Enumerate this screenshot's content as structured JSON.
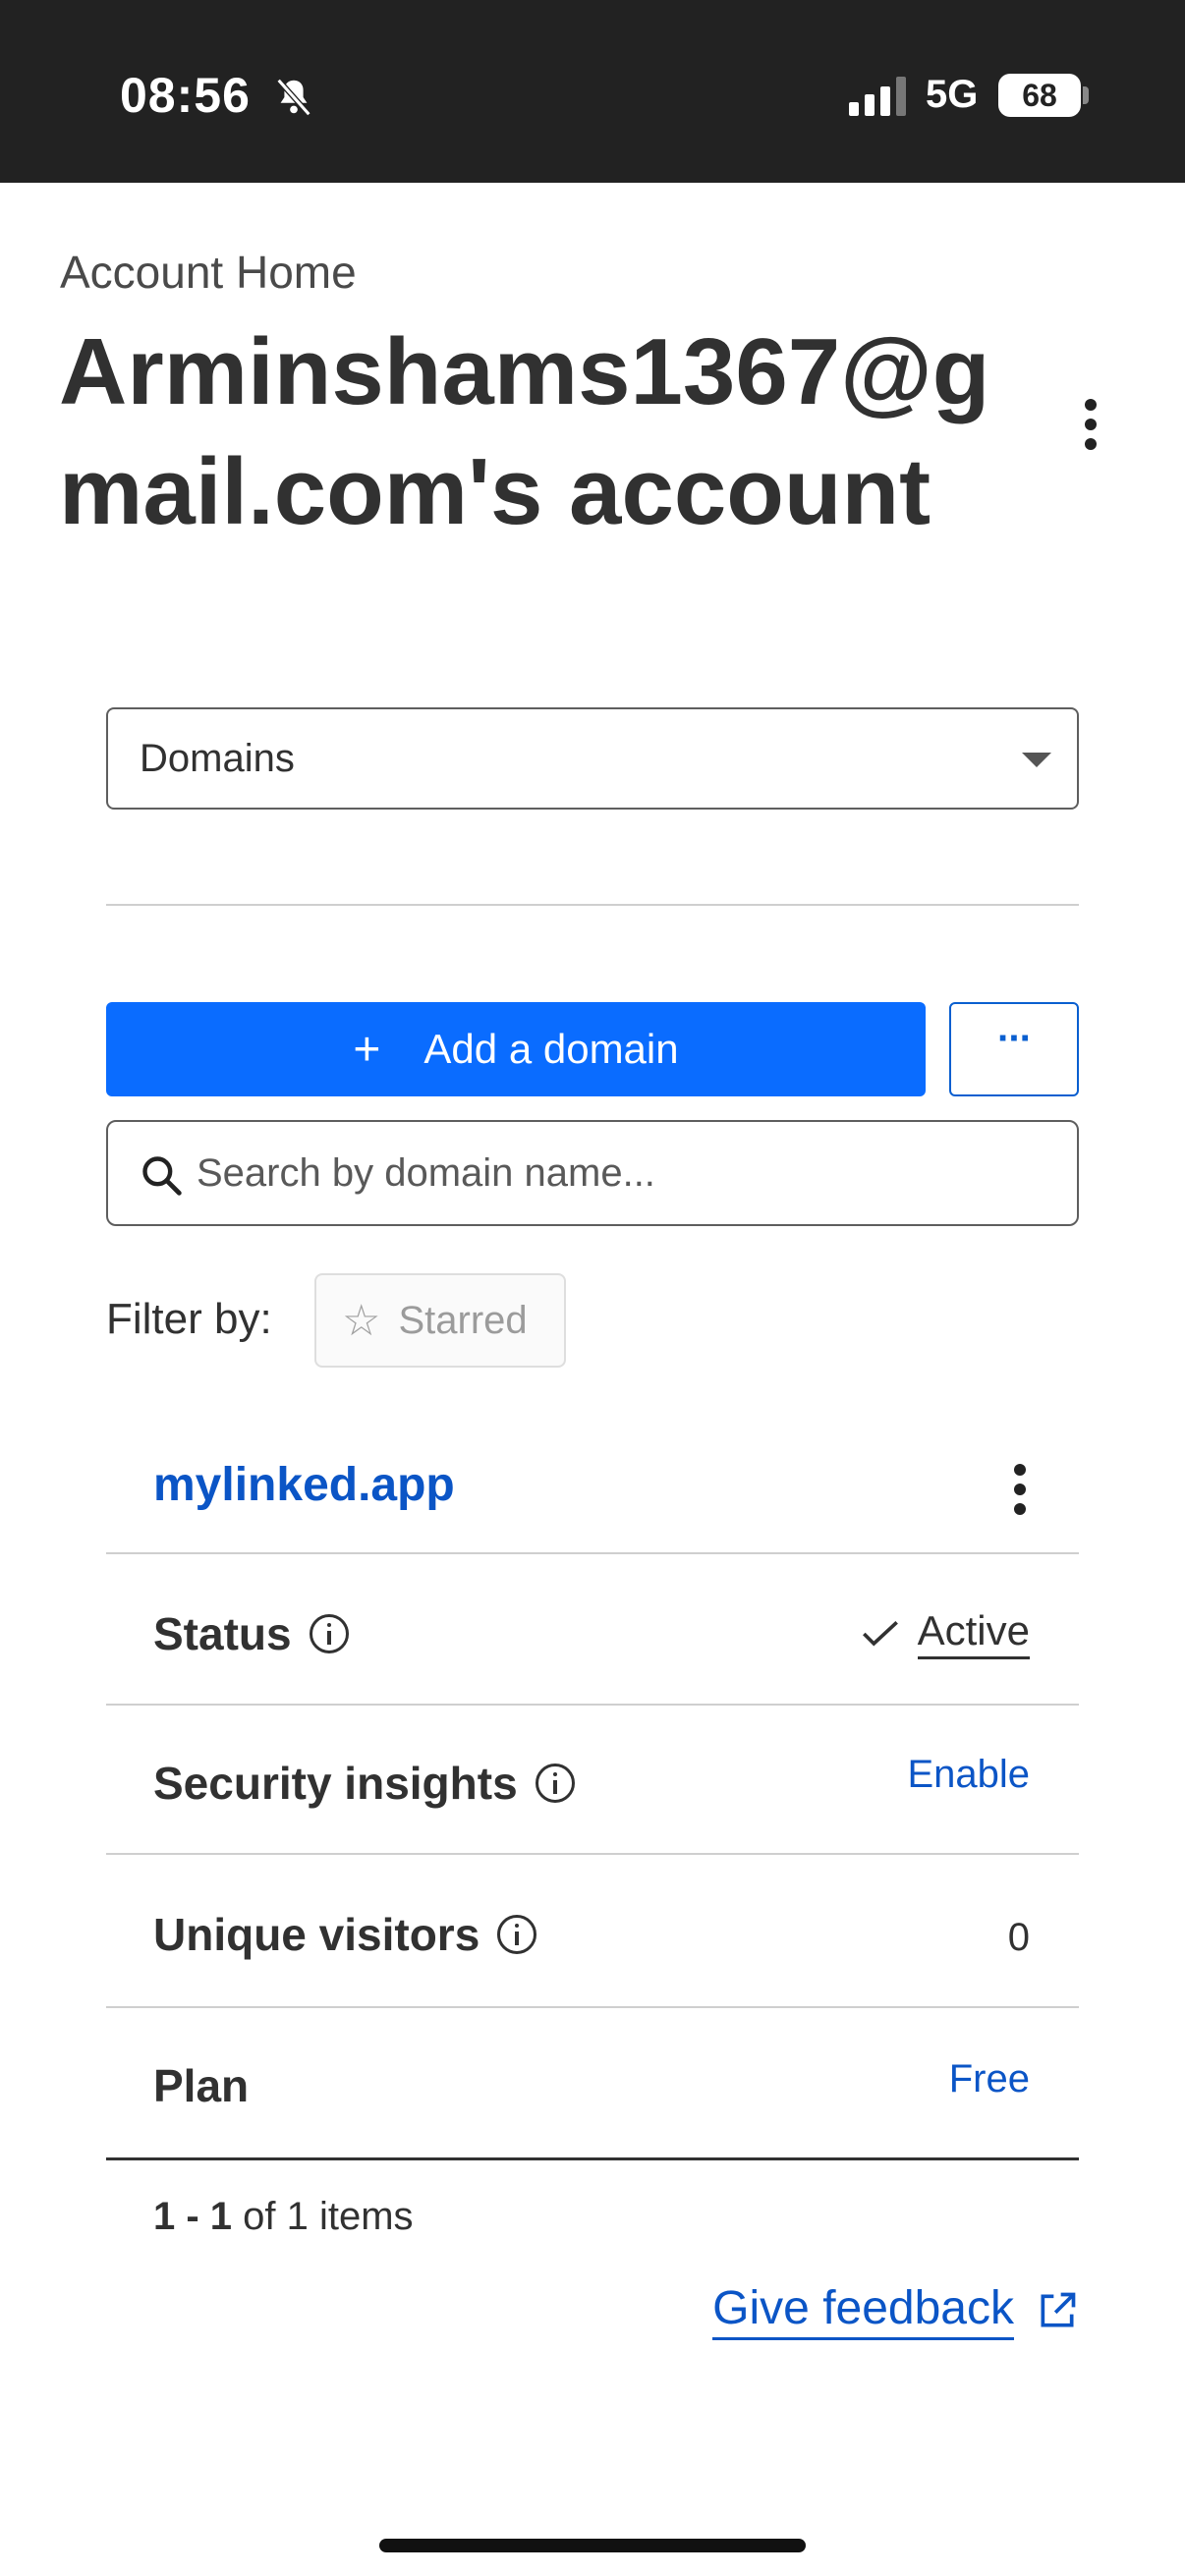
{
  "status_bar": {
    "time": "08:56",
    "network": "5G",
    "battery": "68"
  },
  "header": {
    "breadcrumb": "Account Home",
    "title": "Arminshams1367@gmail.com's account"
  },
  "section_select": {
    "selected": "Domains"
  },
  "toolbar": {
    "add_label": "Add a domain",
    "more_label": "···"
  },
  "search": {
    "placeholder": "Search by domain name..."
  },
  "filter": {
    "label": "Filter by:",
    "starred_label": "Starred"
  },
  "domain": {
    "name": "mylinked.app",
    "rows": {
      "status_label": "Status",
      "status_value": "Active",
      "security_label": "Security insights",
      "security_value": "Enable",
      "visitors_label": "Unique visitors",
      "visitors_value": "0",
      "plan_label": "Plan",
      "plan_value": "Free"
    }
  },
  "pagination": {
    "range": "1 - 1",
    "suffix": " of 1 items"
  },
  "feedback": {
    "label": "Give feedback"
  },
  "colors": {
    "primary": "#0a6cff",
    "link": "#0b55c6",
    "status_bar": "#222222"
  }
}
